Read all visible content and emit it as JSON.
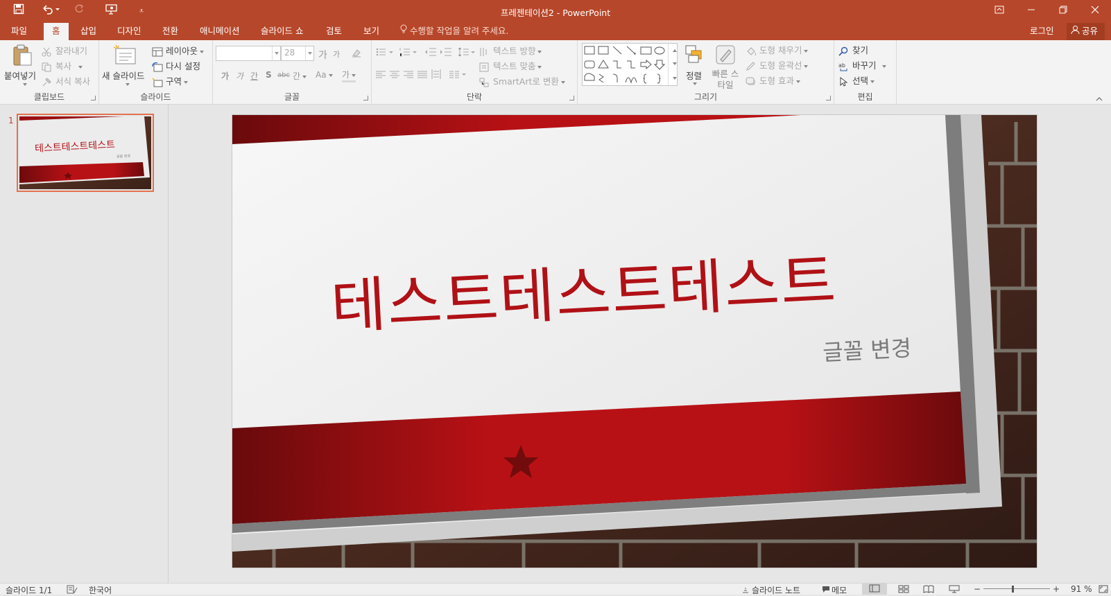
{
  "titlebar": {
    "title": "프레젠테이션2 - PowerPoint",
    "customize_symbol": "⩡"
  },
  "tabs": [
    {
      "label": "파일"
    },
    {
      "label": "홈"
    },
    {
      "label": "삽입"
    },
    {
      "label": "디자인"
    },
    {
      "label": "전환"
    },
    {
      "label": "애니메이션"
    },
    {
      "label": "슬라이드 쇼"
    },
    {
      "label": "검토"
    },
    {
      "label": "보기"
    }
  ],
  "tellme": "수행할 작업을 알려 주세요.",
  "signin": "로그인",
  "share": "공유",
  "ribbon": {
    "clipboard": {
      "label": "클립보드",
      "paste": "붙여넣기",
      "cut": "잘라내기",
      "copy": "복사",
      "format_painter": "서식 복사"
    },
    "slides": {
      "label": "슬라이드",
      "new_slide": "새 슬라이드",
      "layout": "레이아웃",
      "reset": "다시 설정",
      "section": "구역"
    },
    "font": {
      "label": "글꼴",
      "font_name": "",
      "font_size": "28",
      "grow": "가",
      "shrink": "가",
      "bold": "가",
      "italic": "가",
      "underline": "간",
      "shadow": "S",
      "strike": "abc",
      "spacing": "간",
      "case": "Aa",
      "color": "가"
    },
    "paragraph": {
      "label": "단락",
      "text_direction": "텍스트 방향",
      "align_text": "텍스트 맞춤",
      "smartart": "SmartArt로 변환"
    },
    "drawing": {
      "label": "그리기",
      "arrange": "정렬",
      "quick_styles": "빠른 스타일",
      "shape_fill": "도형 채우기",
      "shape_outline": "도형 윤곽선",
      "shape_effects": "도형 효과"
    },
    "editing": {
      "label": "편집",
      "find": "찾기",
      "replace": "바꾸기",
      "select": "선택"
    }
  },
  "thumbnail": {
    "number": "1",
    "title": "테스트테스트테스트",
    "subtitle": "글꼴 변경"
  },
  "slide": {
    "title": "테스트테스트테스트",
    "subtitle": "글꼴 변경"
  },
  "status": {
    "slide_count": "슬라이드 1/1",
    "language": "한국어",
    "notes": "슬라이드 노트",
    "comments": "메모",
    "zoom": "91 %",
    "zoom_minus": "−",
    "zoom_plus": "+"
  },
  "colors": {
    "accent": "#b7472a",
    "slide_red": "#b01116",
    "ribbon_bg": "#f3f3f3"
  }
}
